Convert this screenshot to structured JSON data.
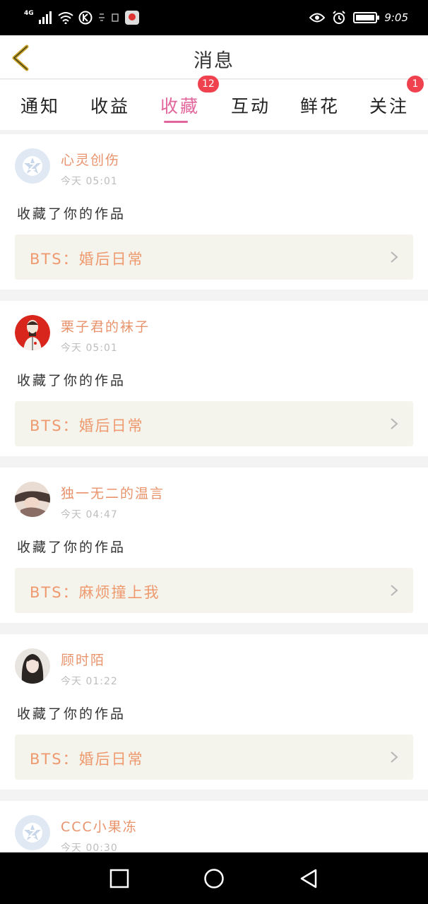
{
  "status_bar": {
    "network": "4G",
    "time": "9:05",
    "battery_level": 0.9,
    "icons": [
      "signal-icon",
      "wifi-icon",
      "k-icon",
      "notification-icon",
      "sim-icon",
      "app-icon",
      "eye-icon",
      "alarm-icon",
      "battery-icon"
    ]
  },
  "header": {
    "title": "消息",
    "back_icon": "back-chevron-icon"
  },
  "tabs": [
    {
      "label": "通知",
      "active": false,
      "badge": ""
    },
    {
      "label": "收益",
      "active": false,
      "badge": ""
    },
    {
      "label": "收藏",
      "active": true,
      "badge": "12"
    },
    {
      "label": "互动",
      "active": false,
      "badge": ""
    },
    {
      "label": "鲜花",
      "active": false,
      "badge": ""
    },
    {
      "label": "关注",
      "active": false,
      "badge": "1"
    }
  ],
  "messages": [
    {
      "username": "心灵创伤",
      "time": "今天 05:01",
      "action": "收藏了你的作品",
      "work": "BTS：婚后日常",
      "avatar": "default-avatar"
    },
    {
      "username": "栗子君的袜子",
      "time": "今天 05:01",
      "action": "收藏了你的作品",
      "work": "BTS：婚后日常",
      "avatar": "red-portrait-avatar"
    },
    {
      "username": "独一无二的温言",
      "time": "今天 04:47",
      "action": "收藏了你的作品",
      "work": "BTS：麻烦撞上我",
      "avatar": "photo-avatar"
    },
    {
      "username": "顾时陌",
      "time": "今天 01:22",
      "action": "收藏了你的作品",
      "work": "BTS：婚后日常",
      "avatar": "photo-avatar"
    },
    {
      "username": "CCC小果冻",
      "time": "今天 00:30",
      "action": "",
      "work": "",
      "avatar": "default-avatar"
    }
  ],
  "colors": {
    "accent_pink": "#e2659c",
    "username_orange": "#e8936c",
    "work_orange": "#ee9a6e",
    "badge_red": "#f0424e",
    "back_arrow": "#c9a227",
    "work_box_bg": "#f4f3ec"
  },
  "nav_bar": {
    "icons": [
      "recent-apps-icon",
      "home-icon",
      "back-icon"
    ]
  }
}
